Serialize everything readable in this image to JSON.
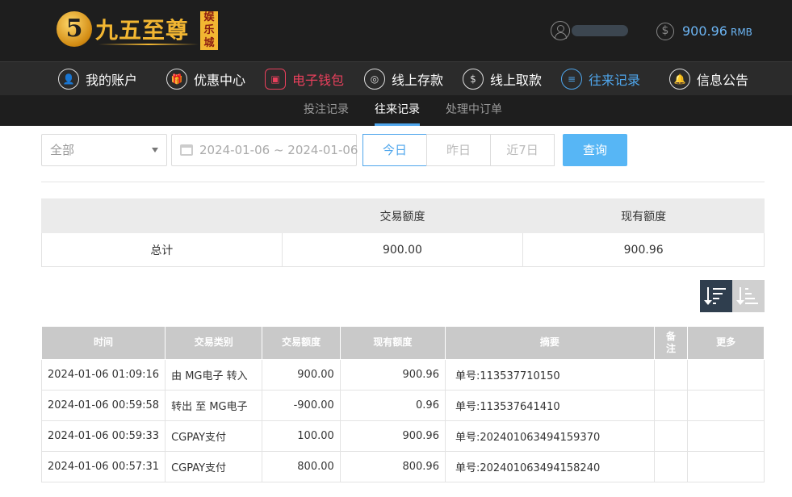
{
  "header": {
    "logo_digit": "5",
    "logo_name": "九五至尊",
    "logo_tag": "娱乐城",
    "balance": "900.96",
    "currency": "RMB",
    "colors": {
      "topbar": "#1e1e1e",
      "accent": "#4fa6ec",
      "gold": "#f2b632",
      "wallet_red": "#e8405c"
    }
  },
  "nav": {
    "items": [
      {
        "label": "我的账户",
        "icon": "user-icon"
      },
      {
        "label": "优惠中心",
        "icon": "gift-icon"
      },
      {
        "label": "电子钱包",
        "icon": "wallet-icon"
      },
      {
        "label": "线上存款",
        "icon": "deposit-icon"
      },
      {
        "label": "线上取款",
        "icon": "withdraw-icon"
      },
      {
        "label": "往来记录",
        "icon": "record-icon"
      },
      {
        "label": "信息公告",
        "icon": "bell-icon"
      }
    ]
  },
  "subnav": {
    "items": [
      "投注记录",
      "往来记录",
      "处理中订单"
    ],
    "active": "往来记录"
  },
  "filter": {
    "type_selected": "全部",
    "date_range": "2024-01-06 ~ 2024-01-06",
    "ranges": [
      "今日",
      "昨日",
      "近7日"
    ],
    "active_range": "今日",
    "query_label": "查询"
  },
  "summary": {
    "headers": [
      "",
      "交易额度",
      "现有额度"
    ],
    "row": {
      "label": "总计",
      "transaction": "900.00",
      "current": "900.96"
    }
  },
  "records": {
    "headers": {
      "time": "时间",
      "type": "交易类别",
      "amount": "交易额度",
      "balance": "现有额度",
      "summary": "摘要",
      "remark_1": "备",
      "remark_2": "注",
      "more": "更多"
    },
    "rows": [
      {
        "time": "2024-01-06 01:09:16",
        "type": "由 MG电子 转入",
        "amount": "900.00",
        "balance": "900.96",
        "summary": "单号:113537710150",
        "remark": "",
        "more": ""
      },
      {
        "time": "2024-01-06 00:59:58",
        "type": "转出 至 MG电子",
        "amount": "-900.00",
        "balance": "0.96",
        "summary": "单号:113537641410",
        "remark": "",
        "more": ""
      },
      {
        "time": "2024-01-06 00:59:33",
        "type": "CGPAY支付",
        "amount": "100.00",
        "balance": "900.96",
        "summary": "单号:202401063494159370",
        "remark": "",
        "more": ""
      },
      {
        "time": "2024-01-06 00:57:31",
        "type": "CGPAY支付",
        "amount": "800.00",
        "balance": "800.96",
        "summary": "单号:202401063494158240",
        "remark": "",
        "more": ""
      }
    ]
  }
}
